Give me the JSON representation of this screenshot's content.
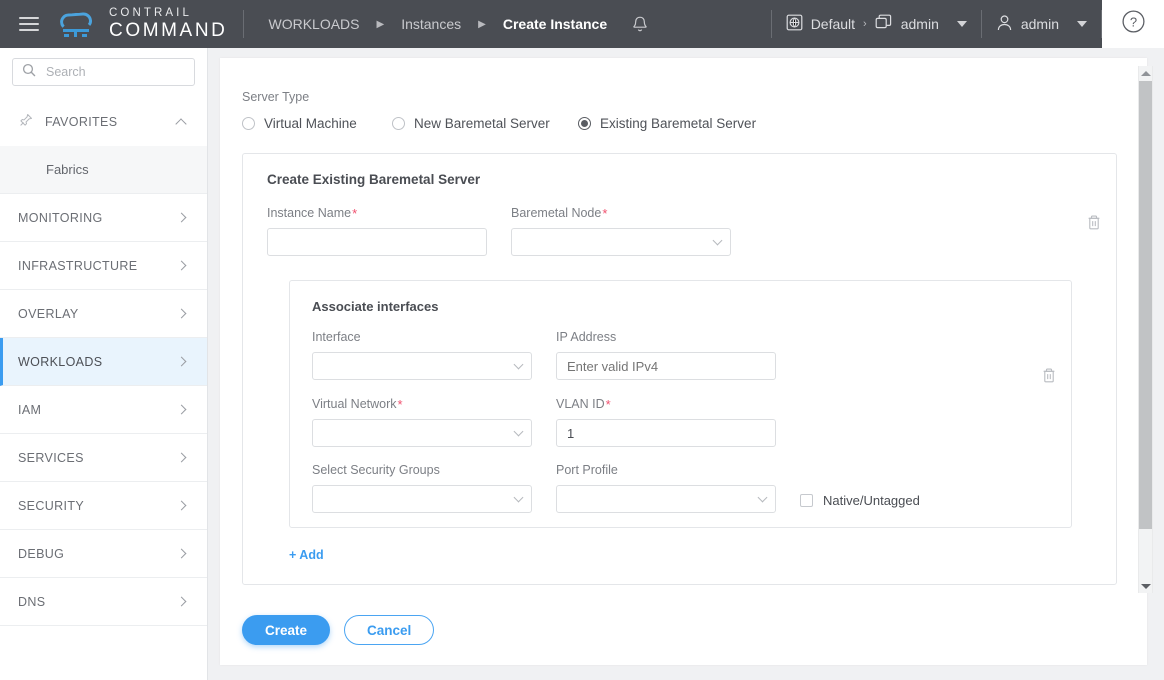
{
  "header": {
    "menu_icon": "hamburger-icon",
    "logo_line1": "CONTRAIL",
    "logo_line2": "COMMAND",
    "breadcrumbs": [
      {
        "label": "WORKLOADS",
        "active": false
      },
      {
        "label": "Instances",
        "active": false
      },
      {
        "label": "Create Instance",
        "active": true
      }
    ],
    "breadcrumb_separator": "▶",
    "bell_icon": "notification-bell-icon",
    "domain_icon": "globe-domain-icon",
    "domain_label": "Default",
    "domain_separator": "›",
    "project_icon": "project-stack-icon",
    "project_label": "admin",
    "user_icon": "user-avatar-icon",
    "user_label": "admin",
    "help_icon": "help-question-icon"
  },
  "sidebar": {
    "search": {
      "placeholder": "Search",
      "value": "",
      "icon": "search-icon"
    },
    "favorites": {
      "label": "FAVORITES",
      "icon": "pin-icon",
      "chevron": "chevron-up-icon"
    },
    "favorite_items": [
      {
        "label": "Fabrics"
      }
    ],
    "items": [
      {
        "label": "MONITORING",
        "selected": false
      },
      {
        "label": "INFRASTRUCTURE",
        "selected": false
      },
      {
        "label": "OVERLAY",
        "selected": false
      },
      {
        "label": "WORKLOADS",
        "selected": true
      },
      {
        "label": "IAM",
        "selected": false
      },
      {
        "label": "SERVICES",
        "selected": false
      },
      {
        "label": "SECURITY",
        "selected": false
      },
      {
        "label": "DEBUG",
        "selected": false
      },
      {
        "label": "DNS",
        "selected": false
      }
    ]
  },
  "main": {
    "server_type_label": "Server Type",
    "server_types": [
      {
        "label": "Virtual Machine",
        "selected": false
      },
      {
        "label": "New Baremetal Server",
        "selected": false
      },
      {
        "label": "Existing Baremetal Server",
        "selected": true
      }
    ],
    "card_title": "Create Existing Baremetal Server",
    "instance_name": {
      "label": "Instance Name",
      "required": true,
      "value": "",
      "placeholder": ""
    },
    "baremetal_node": {
      "label": "Baremetal Node",
      "required": true,
      "value": ""
    },
    "delete_server_icon": "trash-icon",
    "associate": {
      "title": "Associate interfaces",
      "interface": {
        "label": "Interface",
        "required": false,
        "value": ""
      },
      "ip_address": {
        "label": "IP Address",
        "required": false,
        "value": "",
        "placeholder": "Enter valid IPv4"
      },
      "virtual_network": {
        "label": "Virtual Network",
        "required": true,
        "value": ""
      },
      "vlan_id": {
        "label": "VLAN ID",
        "required": true,
        "value": "1"
      },
      "security_groups": {
        "label": "Select Security Groups",
        "required": false,
        "value": ""
      },
      "port_profile": {
        "label": "Port Profile",
        "required": false,
        "value": ""
      },
      "native_untagged": {
        "label": "Native/Untagged",
        "checked": false
      },
      "delete_interface_icon": "trash-icon",
      "add_link": "+ Add"
    }
  },
  "footer": {
    "create_label": "Create",
    "cancel_label": "Cancel"
  },
  "scrollbar": {
    "up_icon": "scroll-up-arrow",
    "down_icon": "scroll-down-arrow"
  },
  "colors": {
    "header_bg": "#4a4d53",
    "accent": "#3b9cf0",
    "logo_blue": "#4ba3dd",
    "required_red": "#f0506e",
    "selected_nav_bg": "#e9f4fd",
    "page_bg": "#f0f1f3"
  }
}
